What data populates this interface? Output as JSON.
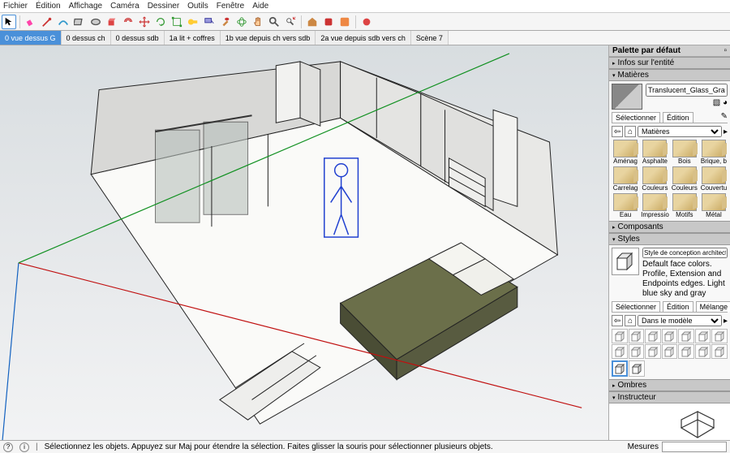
{
  "menu": [
    "Fichier",
    "Édition",
    "Affichage",
    "Caméra",
    "Dessiner",
    "Outils",
    "Fenêtre",
    "Aide"
  ],
  "scenes": [
    {
      "label": "0 vue dessus G",
      "active": true
    },
    {
      "label": "0 dessus ch",
      "active": false
    },
    {
      "label": "0 dessus sdb",
      "active": false
    },
    {
      "label": "1a lit + coffres",
      "active": false
    },
    {
      "label": "1b vue depuis ch vers sdb",
      "active": false
    },
    {
      "label": "2a vue depuis sdb vers ch",
      "active": false
    },
    {
      "label": "Scène 7",
      "active": false
    }
  ],
  "panel": {
    "title": "Palette par défaut",
    "trays": {
      "entity": "Infos sur l'entité",
      "materials": "Matières",
      "components": "Composants",
      "styles": "Styles",
      "shadows": "Ombres",
      "instructor": "Instructeur"
    },
    "material_name": "Translucent_Glass_Gray",
    "mat_tabs": [
      "Sélectionner",
      "Édition"
    ],
    "mat_dropdown_label": "Matières",
    "mat_items": [
      "Aménag",
      "Asphalte",
      "Bois",
      "Brique, b",
      "Carrelag",
      "Couleurs",
      "Couleurs",
      "Couvertu",
      "Eau",
      "Impressio",
      "Motifs",
      "Métal"
    ],
    "style_name": "Style de conception architectura",
    "style_desc": "Default face colors. Profile, Extension and Endpoints edges. Light blue sky and gray",
    "style_tabs": [
      "Sélectionner",
      "Édition",
      "Mélange"
    ],
    "style_dropdown": "Dans le modèle"
  },
  "status": {
    "hint": "Sélectionnez les objets. Appuyez sur Maj pour étendre la sélection. Faites glisser la souris pour sélectionner plusieurs objets.",
    "measure_label": "Mesures"
  }
}
